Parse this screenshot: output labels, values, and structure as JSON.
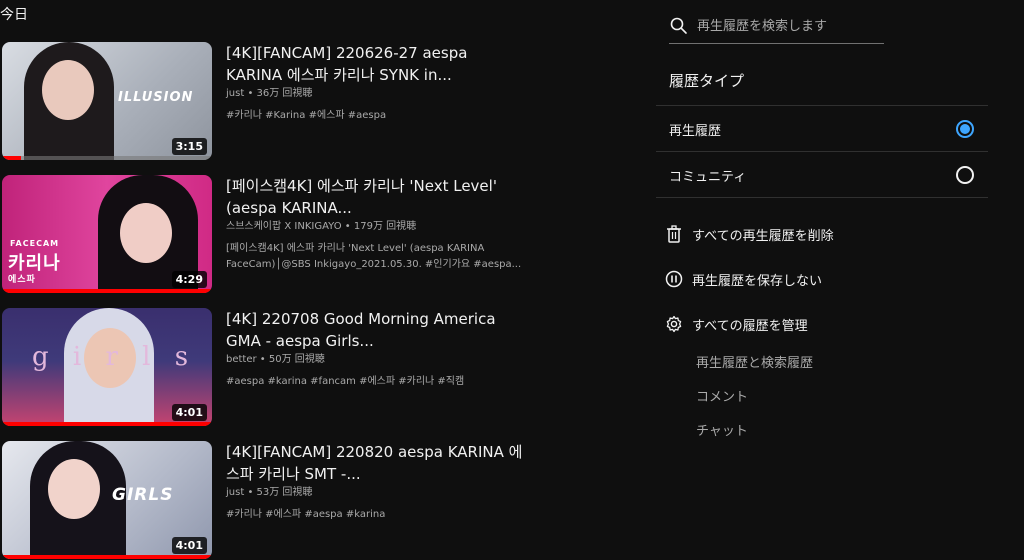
{
  "section": {
    "title": "今日"
  },
  "videos": [
    {
      "title": "[4K][FANCAM] 220626-27 aespa KARINA 에스파 카리나 SYNK in...",
      "channel": "just",
      "views": "36万 回視聴",
      "description": "#카리나 #Karina #에스파 #aespa",
      "duration": "3:15",
      "thumb_overlay": "ILLUSION",
      "progress": 0.09,
      "colors": {
        "bg": "#c9ced6",
        "figure": "#1e1a1c",
        "face": "#e9c9bd",
        "accent": "#b8bcc4"
      }
    },
    {
      "title": "[페이스캠4K] 에스파 카리나 'Next Level' (aespa KARINA...",
      "channel": "스브스케이팝 X INKIGAYO",
      "views": "179万 回視聴",
      "description": "[페이스캠4K] 에스파 카리나 'Next Level' (aespa KARINA FaceCam)│@SBS Inkigayo_2021.05.30. #인기가요 #aespa...",
      "duration": "4:29",
      "thumb_overlay": "카리나",
      "thumb_overlay_small": "FACECAM",
      "thumb_overlay_sub": "에스파",
      "progress": 1.0,
      "colors": {
        "bg": "#d8338f",
        "figure": "#120d12",
        "face": "#f0cdc6",
        "accent": "#ff5fb0"
      }
    },
    {
      "title": "[4K] 220708 Good Morning America GMA - aespa Girls...",
      "channel": "better",
      "views": "50万 回視聴",
      "description": "#aespa #karina #fancam #에스파 #카리나 #직캠",
      "duration": "4:01",
      "thumb_overlay": "g i r l s",
      "progress": 1.0,
      "colors": {
        "bg": "#2b2f63",
        "figure": "#d7d9e8",
        "face": "#ecc6b4",
        "accent": "#d9477e"
      }
    },
    {
      "title": "[4K][FANCAM] 220820 aespa KARINA 에스파 카리나 SMT -...",
      "channel": "just",
      "views": "53万 回視聴",
      "description": "#카리나 #에스파 #aespa #karina",
      "duration": "4:01",
      "thumb_overlay": "GIRLS",
      "progress": 1.0,
      "colors": {
        "bg": "#c3c8d6",
        "figure": "#15121a",
        "face": "#f1d3cb",
        "accent": "#9aa3bb"
      }
    }
  ],
  "sidebar": {
    "search": {
      "placeholder": "再生履歴を検索します"
    },
    "history_type_title": "履歴タイプ",
    "history_types": [
      {
        "label": "再生履歴",
        "checked": true
      },
      {
        "label": "コミュニティ",
        "checked": false
      }
    ],
    "actions": {
      "clear_all": "すべての再生履歴を削除",
      "pause": "再生履歴を保存しない",
      "manage": "すべての履歴を管理"
    },
    "manage_links": [
      "再生履歴と検索履歴",
      "コメント",
      "チャット"
    ]
  },
  "colors": {
    "accent_blue": "#3ea6ff",
    "progress_red": "#ff0000",
    "background": "#0f0f0f"
  }
}
